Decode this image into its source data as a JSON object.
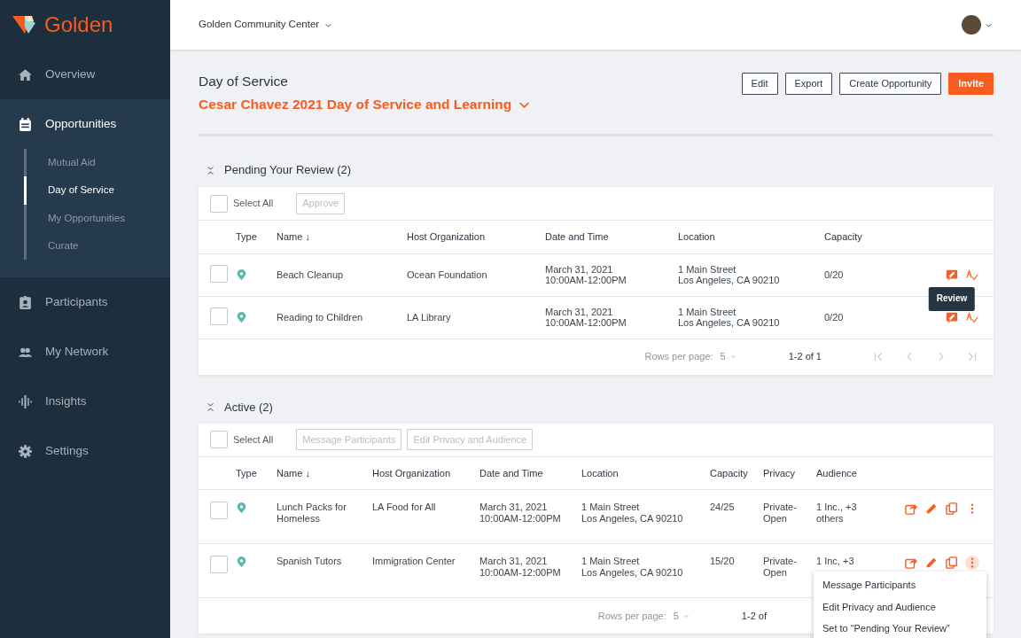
{
  "brand": {
    "name": "Golden"
  },
  "sidebar": {
    "items": [
      {
        "label": "Overview",
        "selected": false
      },
      {
        "label": "Opportunities",
        "selected": true,
        "expanded": true,
        "children": [
          {
            "label": "Mutual Aid",
            "selected": false
          },
          {
            "label": "Day of Service",
            "selected": true
          },
          {
            "label": "My Opportunities",
            "selected": false
          },
          {
            "label": "Curate",
            "selected": false
          }
        ]
      },
      {
        "label": "Participants",
        "selected": false
      },
      {
        "label": "My Network",
        "selected": false
      },
      {
        "label": "Insights",
        "selected": false
      },
      {
        "label": "Settings",
        "selected": false
      }
    ]
  },
  "topbar": {
    "org": "Golden Community Center"
  },
  "page": {
    "section": "Day of Service",
    "title": "Cesar Chavez 2021 Day of Service and Learning",
    "actions": [
      {
        "label": "Edit",
        "kind": "outline"
      },
      {
        "label": "Export",
        "kind": "outline"
      },
      {
        "label": "Create Opportunity",
        "kind": "outline"
      },
      {
        "label": "Invite",
        "kind": "primary"
      }
    ]
  },
  "sections": [
    {
      "title": "Pending Your Review (2)",
      "expanded": true,
      "select_all": "Select All",
      "select_all_checked": false,
      "bulk_actions": [
        {
          "label": "Approve",
          "disabled": true
        }
      ],
      "type_header": "Type",
      "columns": [
        "Name ↓",
        "Host Organization",
        "Date and Time",
        "Location",
        "Capacity"
      ],
      "rows": [
        {
          "checked": false,
          "cells": [
            "Beach Cleanup",
            "Ocean Foundation",
            "March 31, 2021\n10:00AM-12:00PM",
            "1 Main Street\nLos Angeles, CA 90210",
            "0/20"
          ],
          "actions": [
            {
              "kind": "review",
              "tooltip": "Review"
            },
            {
              "kind": "approve"
            }
          ]
        },
        {
          "checked": false,
          "cells": [
            "Reading to Children",
            "LA Library",
            "March 31, 2021\n10:00AM-12:00PM",
            "1 Main Street\nLos Angeles, CA 90210",
            "0/20"
          ],
          "actions": [
            {
              "kind": "review"
            },
            {
              "kind": "approve"
            }
          ]
        }
      ],
      "footer": {
        "rows_label": "Rows per page:",
        "rows_value": "5",
        "range": "1-2 of 1",
        "pager": true
      }
    },
    {
      "title": "Active (2)",
      "expanded": true,
      "select_all": "Select All",
      "select_all_checked": false,
      "bulk_actions": [
        {
          "label": "Message Participants",
          "disabled": true
        },
        {
          "label": "Edit Privacy and Audience",
          "disabled": true
        }
      ],
      "type_header": "Type",
      "columns": [
        "Name ↓",
        "Host Organization",
        "Date and Time",
        "Location",
        "Capacity",
        "Privacy",
        "Audience"
      ],
      "rows": [
        {
          "checked": false,
          "cells": [
            "Lunch Packs for Homeless",
            "LA Food for All",
            "March 31, 2021\n10:00AM-12:00PM",
            "1 Main Street\nLos Angeles, CA 90210",
            "24/25",
            "Private-\nOpen",
            "1 Inc., +3\nothers"
          ],
          "actions": [
            {
              "kind": "share"
            },
            {
              "kind": "edit"
            },
            {
              "kind": "copy"
            },
            {
              "kind": "more",
              "open": false
            }
          ]
        },
        {
          "checked": false,
          "cells": [
            "Spanish Tutors",
            "Immigration Center",
            "March 31, 2021\n10:00AM-12:00PM",
            "1 Main Street\nLos Angeles, CA 90210",
            "15/20",
            "Private-\nOpen",
            "1 Inc, +3"
          ],
          "actions": [
            {
              "kind": "share"
            },
            {
              "kind": "edit"
            },
            {
              "kind": "copy"
            },
            {
              "kind": "more",
              "open": true,
              "menu": [
                "Message Participants",
                "Edit Privacy and Audience",
                "Set to “Pending Your Review”"
              ]
            }
          ]
        }
      ],
      "footer": {
        "rows_label": "Rows per page:",
        "rows_value": "5",
        "range": "1-2 of",
        "pager": false
      }
    }
  ]
}
